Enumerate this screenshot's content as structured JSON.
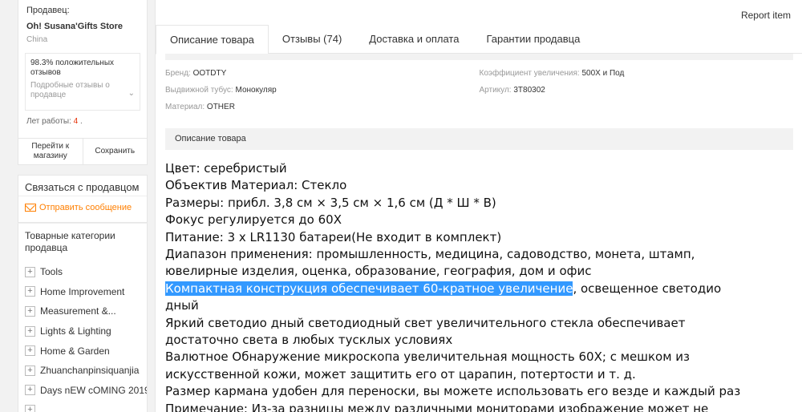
{
  "seller": {
    "label": "Продавец:",
    "name": "Oh! Susana'Gifts Store",
    "country": "China",
    "feedback_percent": "98.3%",
    "feedback_positive_label": "положительных отзывов",
    "feedback_link": "Подробные отзывы о продавце",
    "years_label": "Лет работы:",
    "years_value": "4",
    "years_suffix": ".",
    "btn_visit": "Перейти к магазину",
    "btn_save": "Сохранить"
  },
  "contact": {
    "title": "Связаться с продавцом",
    "message": "Отправить сообщение"
  },
  "categories": {
    "title": "Товарные категории продавца",
    "items": [
      "Tools",
      "Home Improvement",
      "Measurement &...",
      "Lights & Lighting",
      "Home & Garden",
      "Zhuanchanpinsiquanjia",
      "Days nEW cOMING 2019"
    ]
  },
  "report": "Report item",
  "tabs": [
    "Описание товара",
    "Отзывы (74)",
    "Доставка и оплата",
    "Гарантии продавца"
  ],
  "specs": [
    {
      "key": "Бренд:",
      "value": "OOTDTY"
    },
    {
      "key": "Коэффициент увеличения:",
      "value": "500X и Под"
    },
    {
      "key": "Выдвижной тубус:",
      "value": "Монокуляр"
    },
    {
      "key": "Артикул:",
      "value": "3T80302"
    },
    {
      "key": "Материал:",
      "value": "OTHER"
    }
  ],
  "desc_header": "Описание товара",
  "description": {
    "l1": "Цвет: серебристый",
    "l2": "Объектив Материал: Стекло",
    "l3": "Размеры: прибл. 3,8 см × 3,5 см × 1,6 см (Д * Ш * В)",
    "l4": "Фокус регулируется до 60X",
    "l5": "Питание: 3 x LR1130 батареи(Не входит в комплект)",
    "l6": "Диапазон применения: промышленность, медицина, садоводство, монета, штамп,",
    "l7": "ювелирные изделия, оценка, образование, география, дом и офис",
    "l8_hl": "Компактная конструкция обеспечивает 60-кратное увеличение",
    "l8_rest": ", освещенное светодио",
    "l9": "дный",
    "l10": "Яркий светодио дный светодиодный свет увеличительного стекла обеспечивает",
    "l11": "достаточно света в любых тусклых условиях",
    "l12": "Валютное Обнаружение микроскопа увеличительная мощность 60X; с мешком из",
    "l13": "искусственной кожи, может защитить его от царапин, потертости и т. д.",
    "l14": "Размер кармана удобен для переноски, вы можете использовать его везде и каждый раз",
    "l15": "Примечание: Из-за разницы между различными мониторами изображение может не"
  }
}
